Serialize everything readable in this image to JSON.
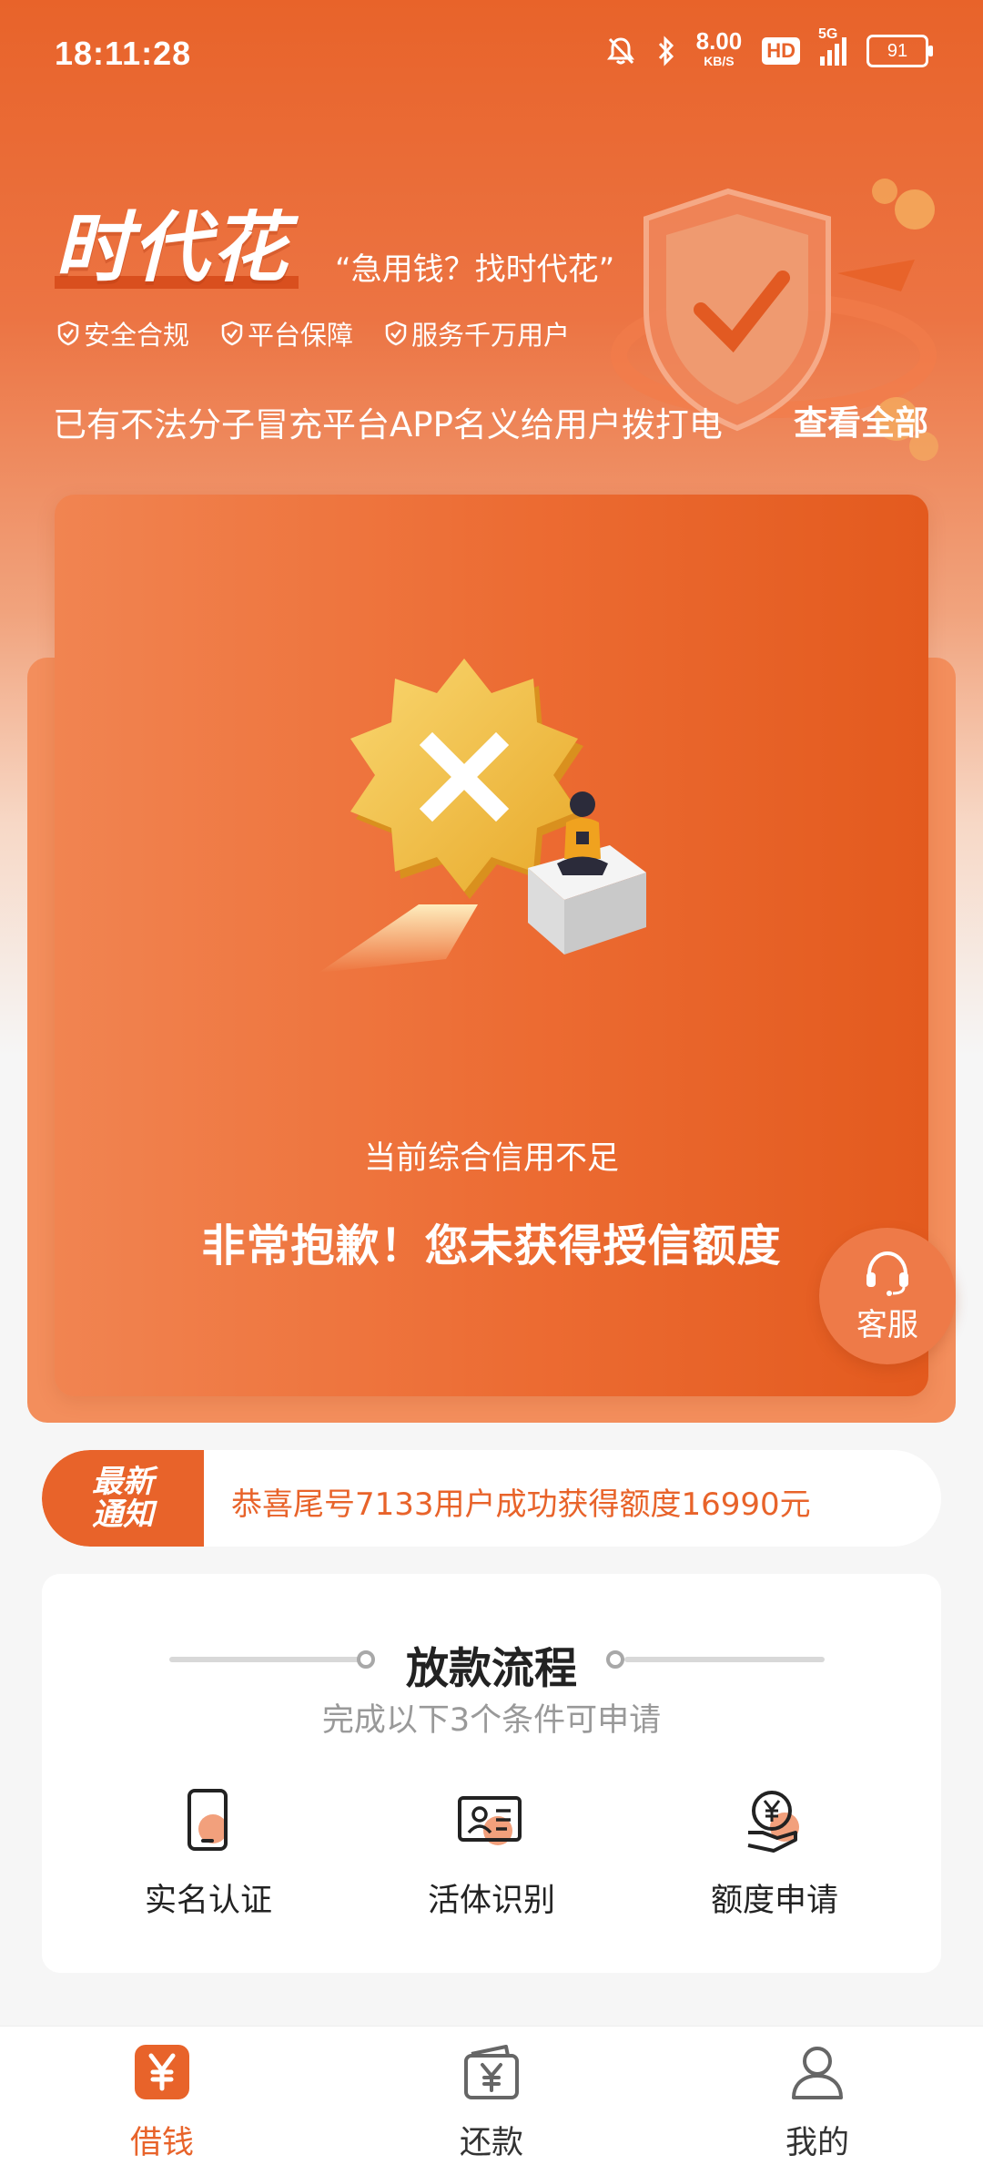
{
  "status_bar": {
    "time": "18:11:28",
    "net_speed": "8.00",
    "net_unit": "KB/S",
    "hd": "HD",
    "network": "5G",
    "battery": "91"
  },
  "header": {
    "brand_name": "时代花",
    "slogan": "“急用钱？找时代花”",
    "badges": [
      "安全合规",
      "平台保障",
      "服务千万用户"
    ],
    "notice": "已有不法分子冒充平台APP名义给用户拨打电",
    "view_all": "查看全部"
  },
  "result_card": {
    "reason": "当前综合信用不足",
    "title": "非常抱歉！您未获得授信额度",
    "service_label": "客服"
  },
  "ticker": {
    "tag_line1": "最新",
    "tag_line2": "通知",
    "text": "恭喜尾号7133用户成功获得额度16990元"
  },
  "process": {
    "title": "放款流程",
    "subtitle": "完成以下3个条件可申请",
    "steps": [
      {
        "label": "实名认证",
        "icon": "phone-icon"
      },
      {
        "label": "活体识别",
        "icon": "id-card-icon"
      },
      {
        "label": "额度申请",
        "icon": "yen-hand-icon"
      }
    ]
  },
  "tabbar": {
    "items": [
      {
        "label": "借钱",
        "icon": "yen-icon",
        "active": true
      },
      {
        "label": "还款",
        "icon": "wallet-icon",
        "active": false
      },
      {
        "label": "我的",
        "icon": "user-icon",
        "active": false
      }
    ]
  },
  "colors": {
    "accent": "#e8632a",
    "tab_active": "#e8632a",
    "tab_inactive": "#333333"
  }
}
